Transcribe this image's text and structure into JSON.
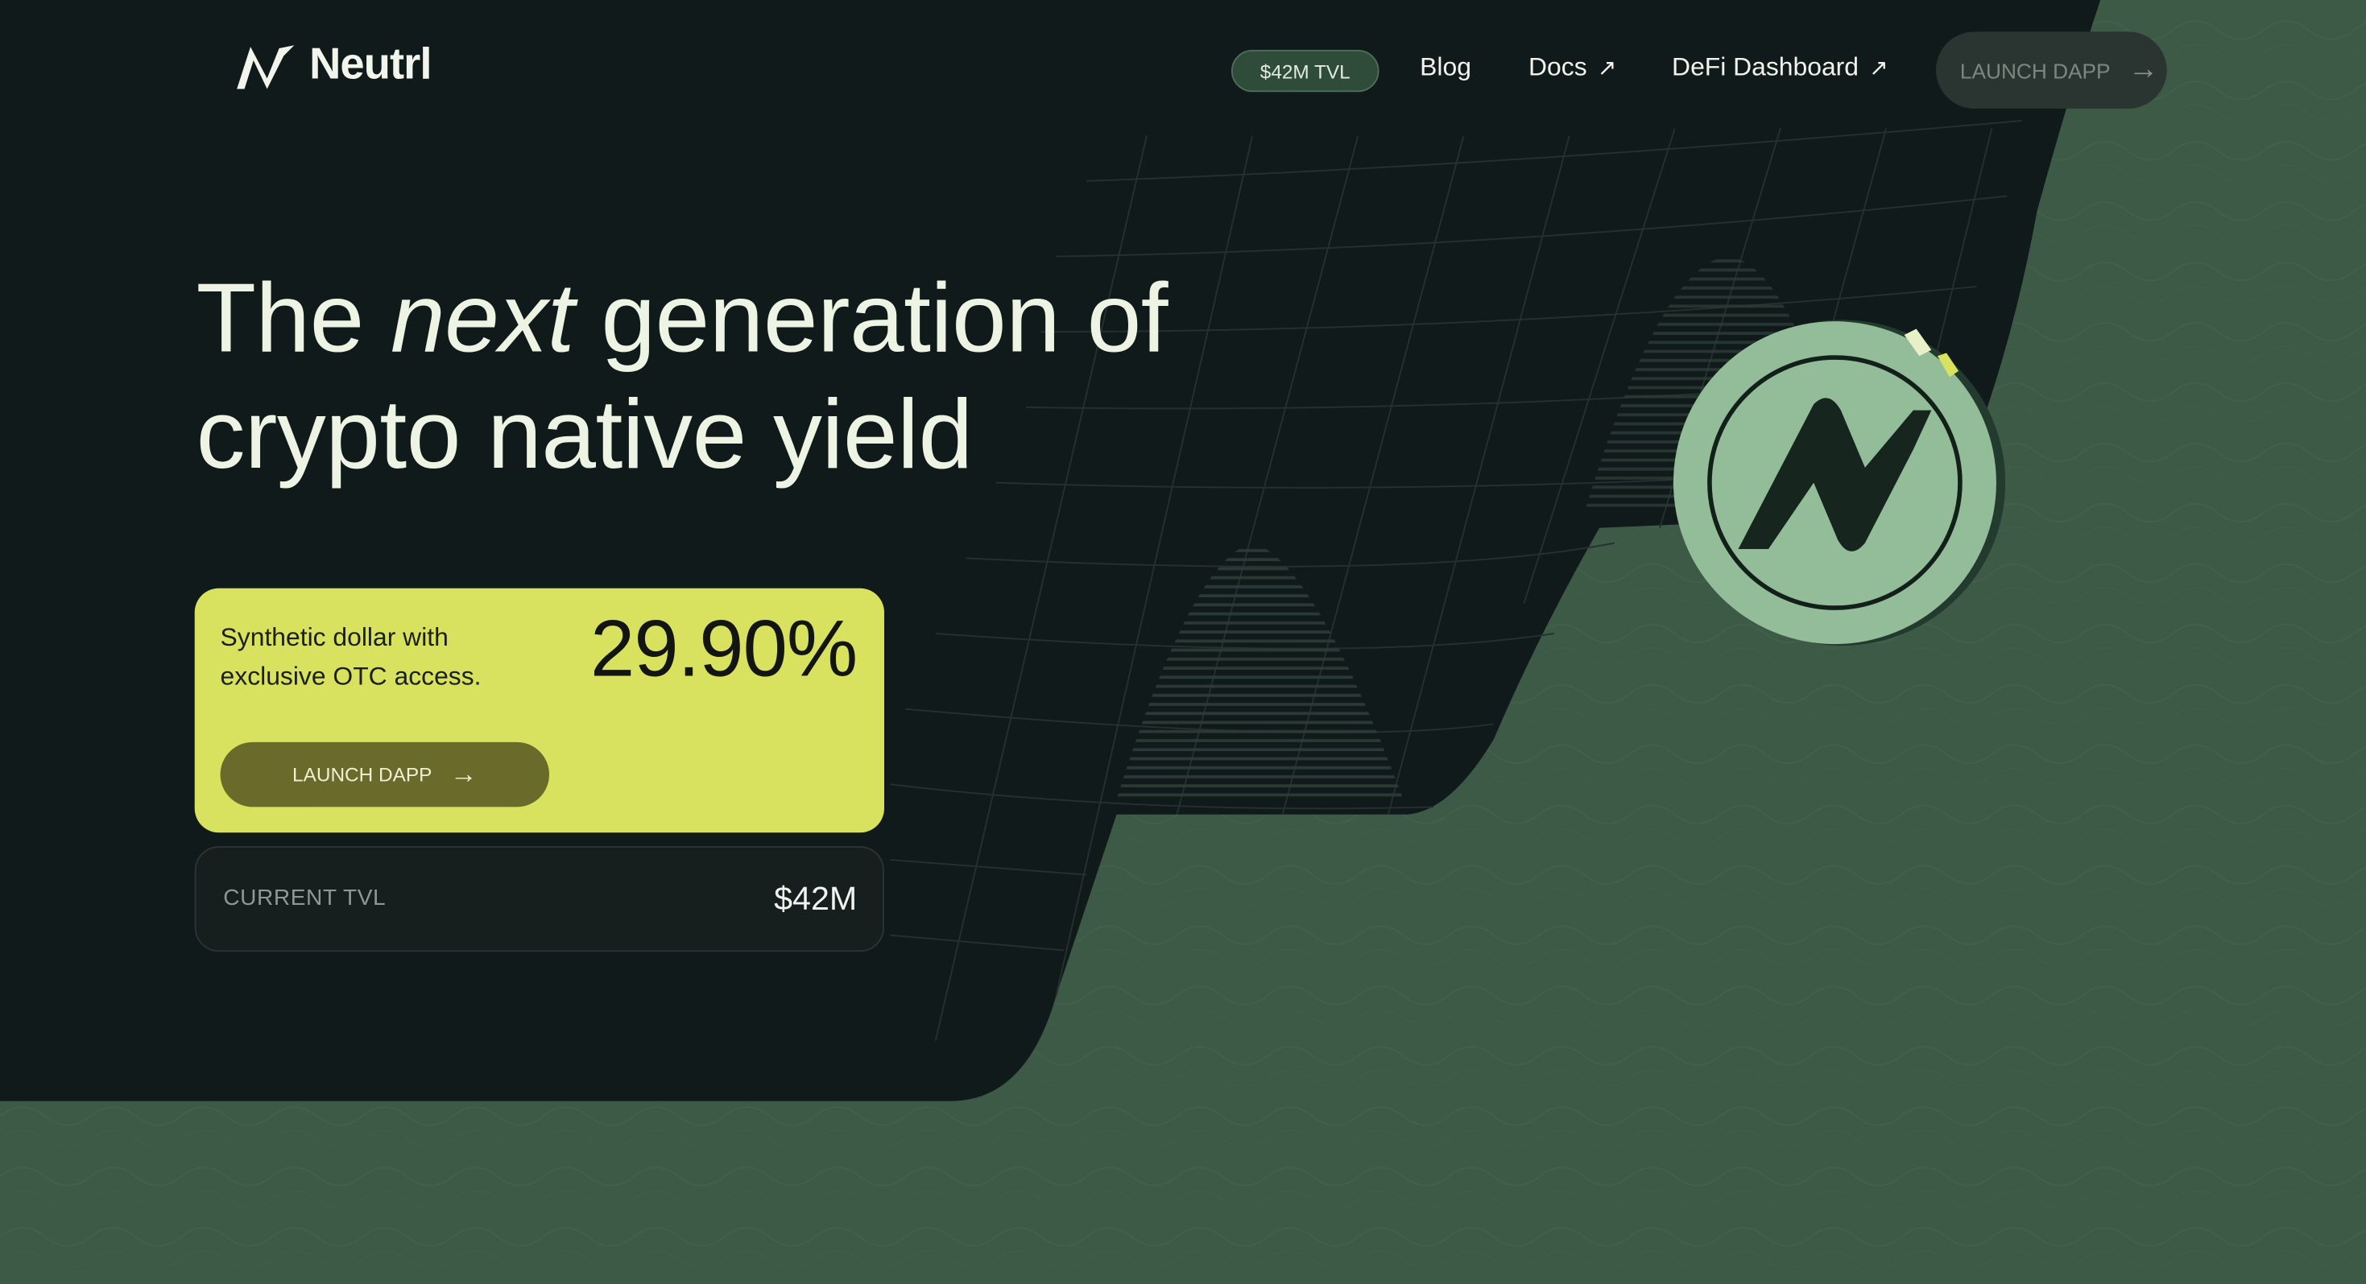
{
  "brand": {
    "name": "Neutrl",
    "logo_icon": "n-logo-icon"
  },
  "nav": {
    "tvl_badge": "$42M TVL",
    "links": [
      {
        "label": "Blog",
        "external": false
      },
      {
        "label": "Docs",
        "external": true
      },
      {
        "label": "DeFi Dashboard",
        "external": true
      }
    ],
    "launch_label": "LAUNCH DAPP"
  },
  "hero": {
    "line1_a": "The",
    "line1_em": "next",
    "line1_b": "generation of",
    "line2": "crypto native yield"
  },
  "apy_card": {
    "description": "Synthetic dollar with exclusive OTC access.",
    "apy": "29.90%",
    "button_label": "LAUNCH DAPP"
  },
  "tvl_card": {
    "label": "CURRENT TVL",
    "value": "$42M"
  },
  "colors": {
    "dark_bg": "#111a1a",
    "green_bg": "#3c5a45",
    "accent_lime": "#d9e25f",
    "coin_green": "#93bd98"
  }
}
